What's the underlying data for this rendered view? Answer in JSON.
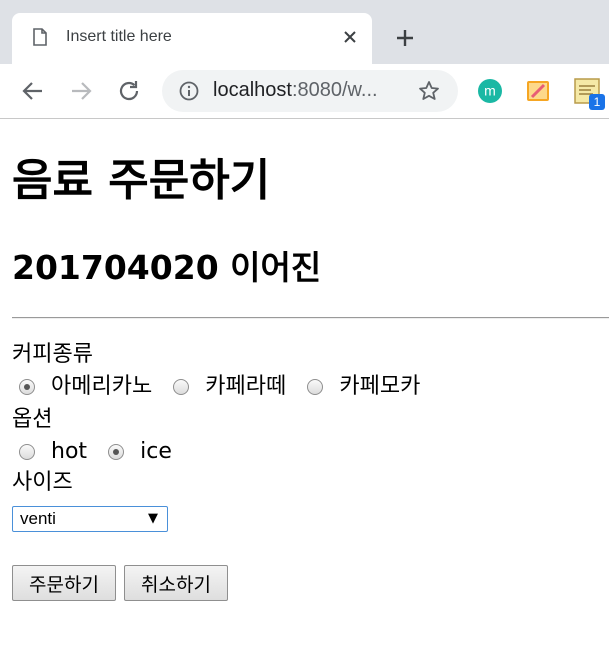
{
  "browser": {
    "tab_title": "Insert title here",
    "url_host": "localhost",
    "url_rest": ":8080/w...",
    "extension_badge": "1"
  },
  "page": {
    "title": "음료 주문하기",
    "student": "201704020 이어진",
    "coffee_label": "커피종류",
    "coffee_options": [
      {
        "label": "아메리카노",
        "checked": true
      },
      {
        "label": "카페라떼",
        "checked": false
      },
      {
        "label": "카페모카",
        "checked": false
      }
    ],
    "option_label": "옵션",
    "temp_options": [
      {
        "label": "hot",
        "checked": false
      },
      {
        "label": "ice",
        "checked": true
      }
    ],
    "size_label": "사이즈",
    "size_selected": "venti",
    "order_button": "주문하기",
    "cancel_button": "취소하기"
  },
  "colors": {
    "tabstrip": "#dee1e6",
    "omnibox": "#f1f3f4",
    "select_focus": "#4a90d9"
  }
}
